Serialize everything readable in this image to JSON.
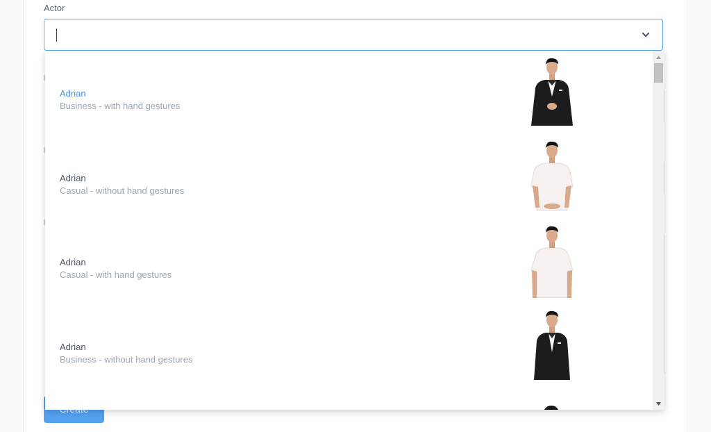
{
  "form": {
    "actor_label": "Actor",
    "select_value": "",
    "create_label": "Create"
  },
  "dropdown": {
    "options": [
      {
        "name": "Adrian",
        "description": "Business - with hand gestures",
        "outfit": "business-suit",
        "highlighted": true
      },
      {
        "name": "Adrian",
        "description": "Casual - without hand gestures",
        "outfit": "white-tshirt",
        "highlighted": false
      },
      {
        "name": "Adrian",
        "description": "Casual - with hand gestures",
        "outfit": "white-tshirt",
        "highlighted": false
      },
      {
        "name": "Adrian",
        "description": "Business - without hand gestures",
        "outfit": "business-suit",
        "highlighted": false
      }
    ]
  },
  "colors": {
    "accent": "#4a90e2",
    "border_focus": "#58a6f0",
    "button": "#4c9df1"
  },
  "icons": [
    "chevron-down-icon",
    "scroll-up-arrow-icon",
    "scroll-down-arrow-icon"
  ]
}
